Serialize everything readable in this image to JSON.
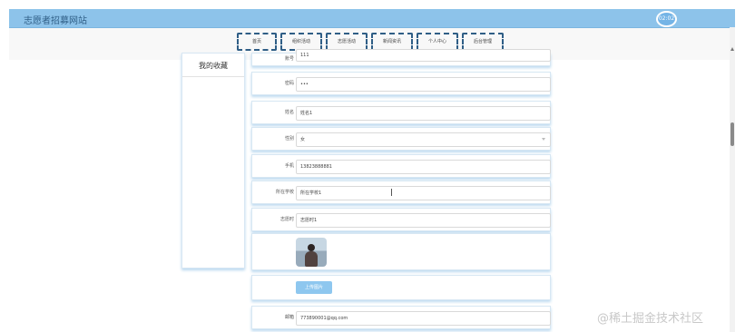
{
  "header": {
    "site_title": "志愿者招募网站",
    "time_badge": "02:02"
  },
  "nav": {
    "items": [
      "首页",
      "组织活动",
      "志愿活动",
      "新闻资讯",
      "个人中心",
      "后台管理"
    ]
  },
  "favorites": {
    "title": "我的收藏"
  },
  "form": {
    "account_label": "账号",
    "account_value": "111",
    "password_label": "密码",
    "password_value": "•••",
    "name_label": "姓名",
    "name_value": "姓名1",
    "gender_label": "性别",
    "gender_value": "女",
    "phone_label": "手机",
    "phone_value": "13823888881",
    "school_label": "所在学校",
    "school_value": "所在学校1",
    "hours_label": "志愿时",
    "hours_value": "志愿时1",
    "upload_label": "上传图片",
    "email_label": "邮箱",
    "email_value": "773890001@qq.com"
  },
  "watermark": "@稀土掘金技术社区"
}
